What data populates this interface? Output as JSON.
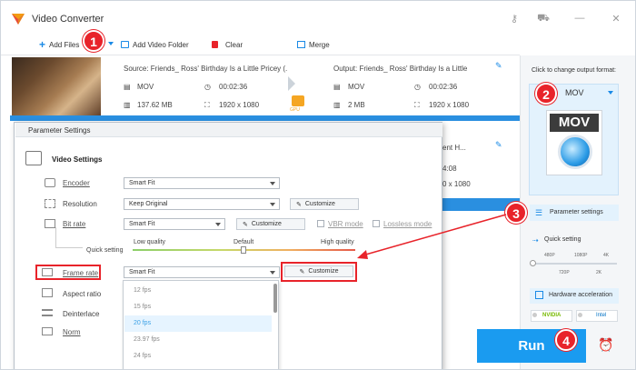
{
  "app": {
    "title": "Video Converter"
  },
  "toolbar": {
    "add_files": "Add Files",
    "add_video_folder": "Add Video Folder",
    "clear": "Clear",
    "merge": "Merge"
  },
  "badges": {
    "b1": "1",
    "b2": "2",
    "b3": "3",
    "b4": "4"
  },
  "source": {
    "title": "Source: Friends_ Ross' Birthday Is a Little Pricey (...",
    "format": "MOV",
    "duration": "00:02:36",
    "size": "137.62 MB",
    "resolution": "1920 x 1080"
  },
  "gpu": {
    "label": "GPU"
  },
  "output": {
    "title": "Output: Friends_ Ross' Birthday Is a Little P...",
    "format": "MOV",
    "duration": "00:02:36",
    "size": "2 MB",
    "resolution": "1920 x 1080"
  },
  "row2_partial": {
    "title_tail": "ent H...",
    "duration_tail": "4:08",
    "res_tail": "0 x 1080"
  },
  "right": {
    "click_text": "Click to change output format:",
    "format_name": "MOV",
    "format_icon_text": "MOV",
    "param_settings": "Parameter settings",
    "quick_setting": "Quick setting",
    "q_labels": [
      "480P",
      "1080P",
      "4K"
    ],
    "q_labels2": [
      "720P",
      "2K"
    ],
    "hw_accel": "Hardware acceleration",
    "nvidia": "NVIDIA",
    "intel": "Intel"
  },
  "run": {
    "label": "Run"
  },
  "dialog": {
    "title": "Parameter Settings",
    "section": "Video Settings",
    "encoder": {
      "label": "Encoder",
      "value": "Smart Fit"
    },
    "resolution": {
      "label": "Resolution",
      "value": "Keep Original",
      "button": "Customize"
    },
    "bitrate": {
      "label": "Bit rate",
      "value": "Smart Fit",
      "button": "Customize",
      "vbr": "VBR mode",
      "lossless": "Lossless mode"
    },
    "quick": {
      "label": "Quick setting",
      "low": "Low quality",
      "default": "Default",
      "high": "High quality"
    },
    "framerate": {
      "label": "Frame rate",
      "value": "Smart Fit",
      "button": "Customize"
    },
    "aspect": {
      "label": "Aspect ratio"
    },
    "deinterlace": {
      "label": "Deinterlace"
    },
    "norm": {
      "label": "Norm"
    },
    "fps_options": [
      "12 fps",
      "15 fps",
      "20 fps",
      "23.97 fps",
      "24 fps"
    ]
  }
}
